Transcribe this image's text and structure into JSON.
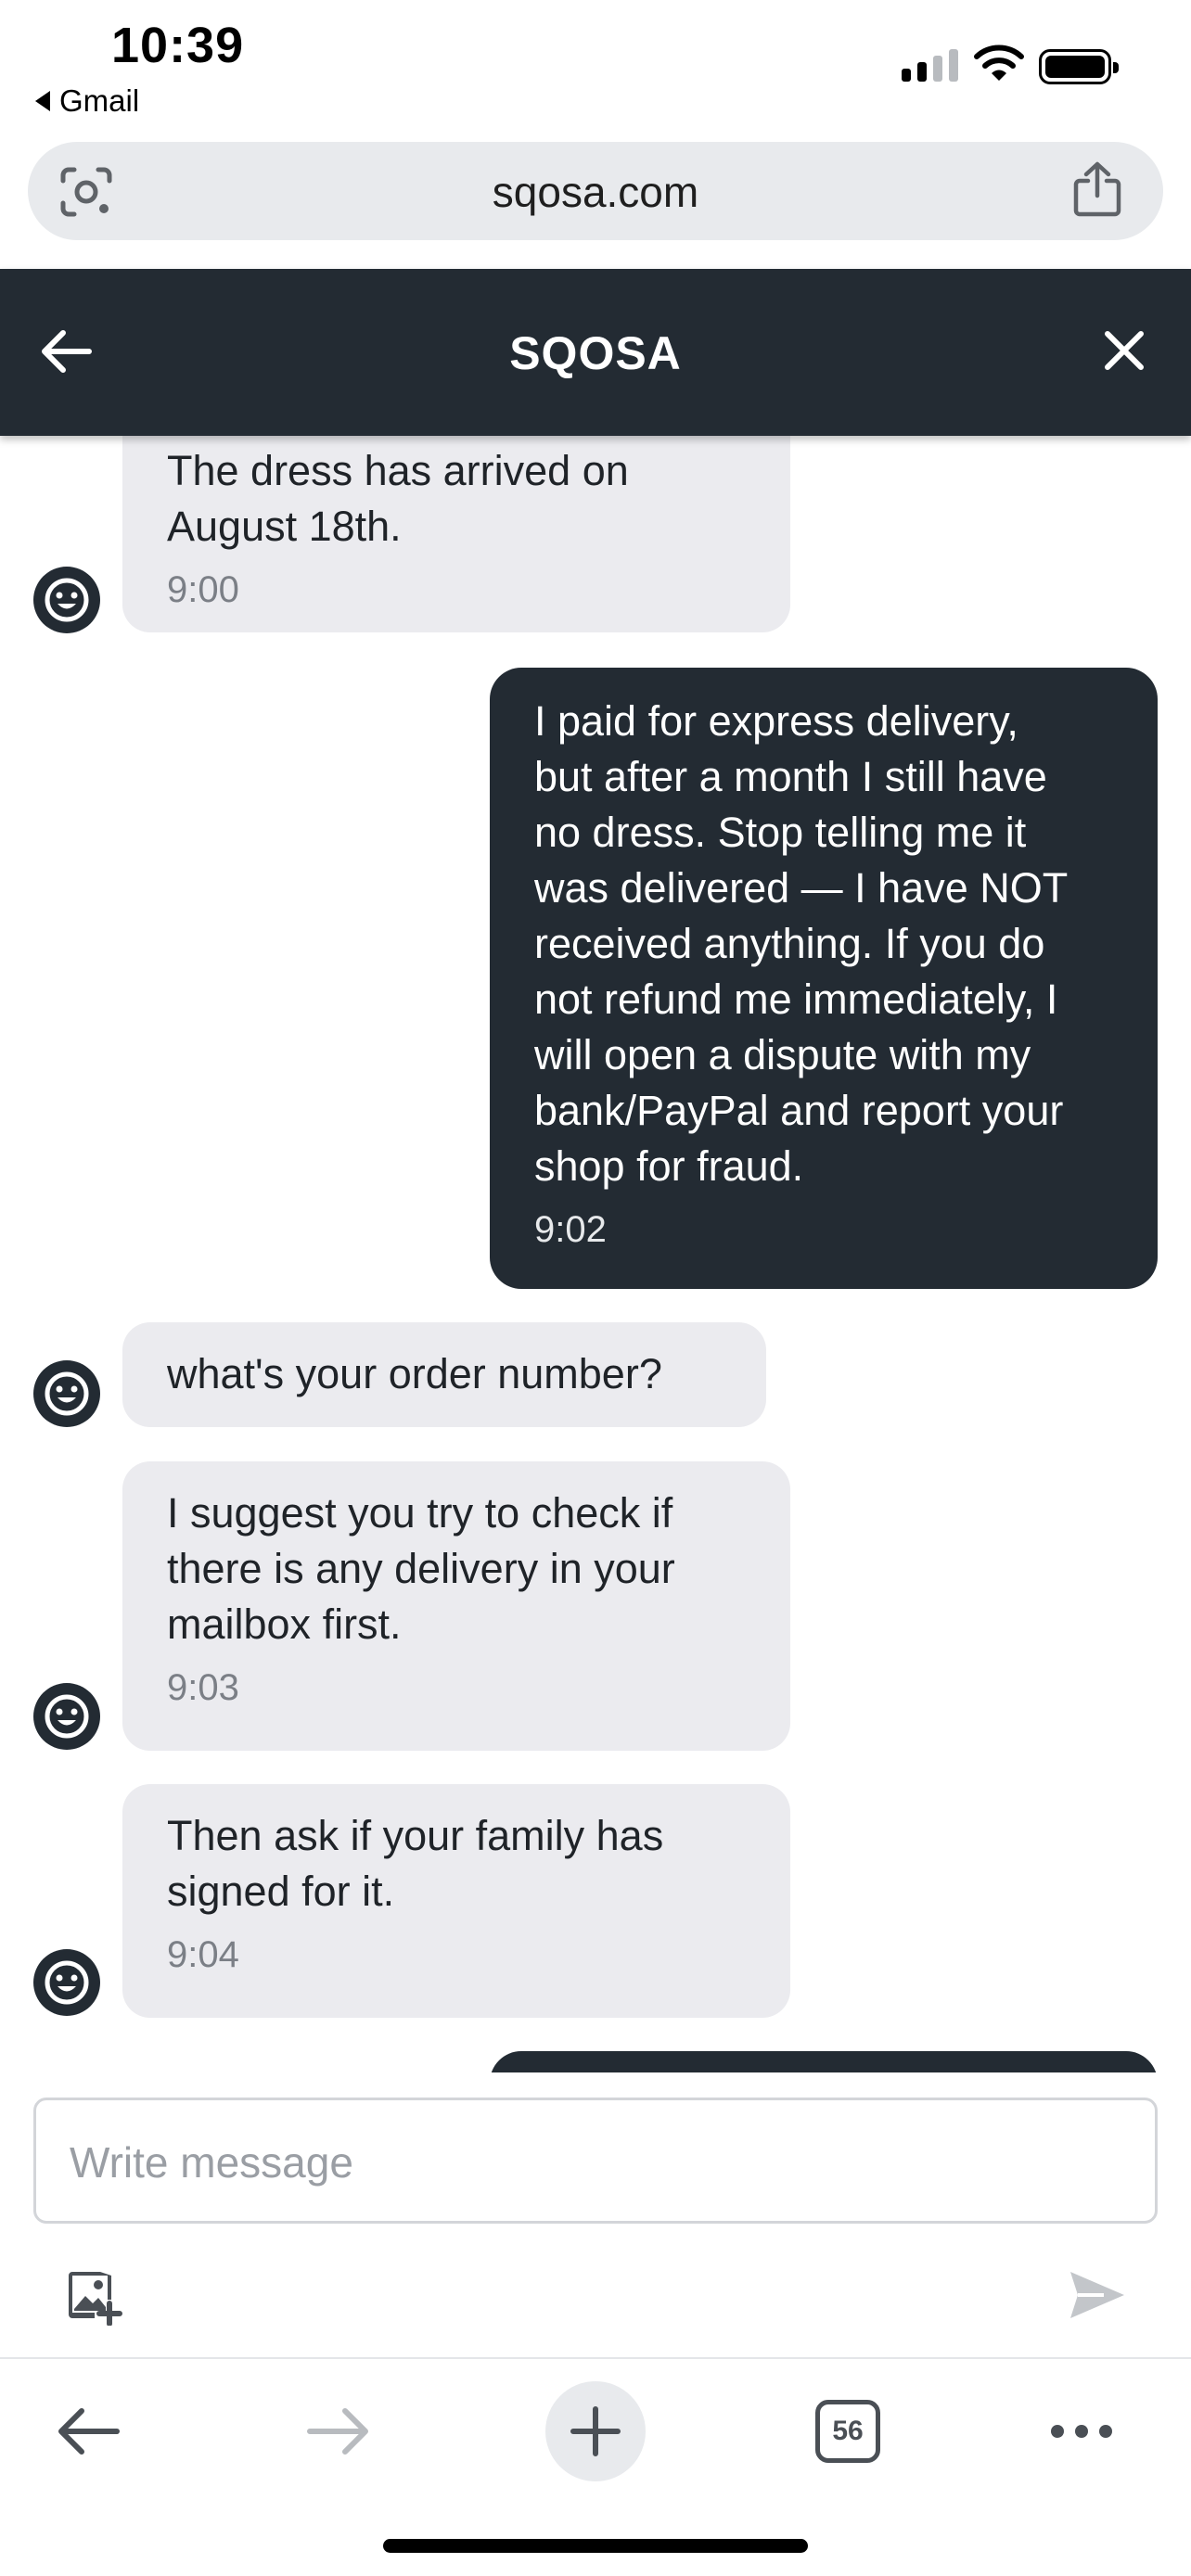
{
  "status_bar": {
    "time": "10:39",
    "back_app": "Gmail"
  },
  "browser": {
    "url": "sqosa.com",
    "tab_count": "56"
  },
  "chat": {
    "title": "SQOSA",
    "composer_placeholder": "Write message",
    "messages": [
      {
        "direction": "incoming",
        "text": "The dress has arrived on\nAugust 18th.",
        "time": "9:00"
      },
      {
        "direction": "outgoing",
        "text": "I paid for express delivery,\nbut after a month I still have\nno dress. Stop telling me it\nwas delivered — I have NOT\nreceived anything. If you do\nnot refund me immediately, I\nwill open a dispute with my\nbank/PayPal and report your\nshop for fraud.",
        "time": "9:02"
      },
      {
        "direction": "incoming",
        "text": "what's your order number?",
        "time": ""
      },
      {
        "direction": "incoming",
        "text": "I suggest you try to check if\nthere is any delivery in your\nmailbox first.",
        "time": "9:03"
      },
      {
        "direction": "incoming",
        "text": "Then ask if your family has\nsigned for it.",
        "time": "9:04"
      },
      {
        "direction": "outgoing",
        "text": "",
        "time": ""
      }
    ]
  },
  "colors": {
    "header_bg": "#232b33",
    "outgoing_bubble": "#232b33",
    "incoming_bubble": "#ebebef",
    "url_bar_bg": "#e8eaed"
  },
  "icons": {
    "url_left": "lens-icon",
    "url_right": "share-icon",
    "header_left": "arrow-left-icon",
    "header_right": "close-icon",
    "avatar": "smiley-face-icon",
    "attach": "image-add-icon",
    "send": "send-icon",
    "toolbar": [
      "back-arrow-icon",
      "forward-arrow-icon",
      "plus-icon",
      "tabs-icon",
      "more-icon"
    ]
  }
}
